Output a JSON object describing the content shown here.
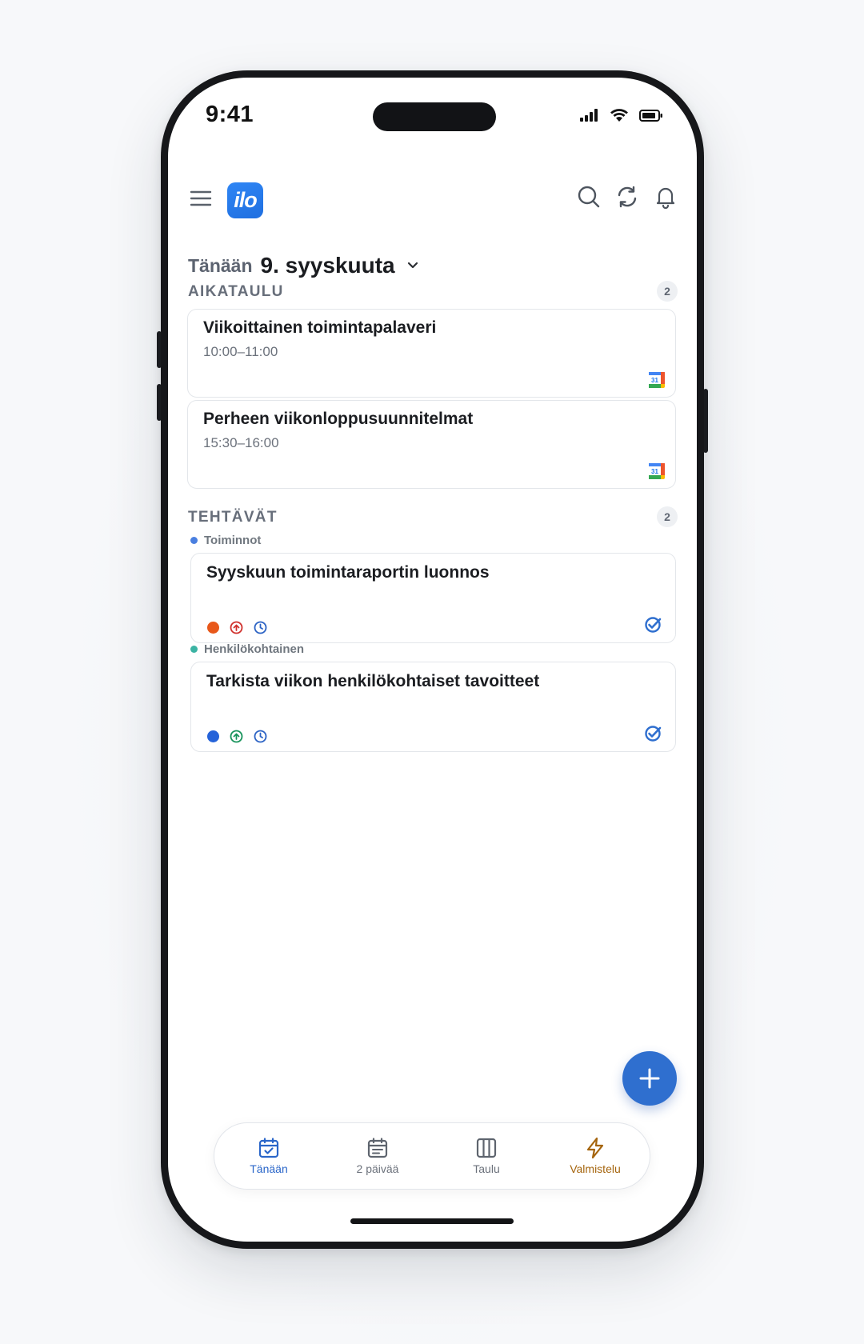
{
  "status": {
    "time": "9:41"
  },
  "header": {
    "logo_text": "ilo"
  },
  "date": {
    "today_label": "Tänään",
    "date_label": "9. syyskuuta"
  },
  "schedule": {
    "title": "AIKATAULU",
    "count": "2",
    "events": [
      {
        "title": "Viikoittainen toimintapalaveri",
        "time": "10:00–11:00"
      },
      {
        "title": "Perheen viikonloppusuunnitelmat",
        "time": "15:30–16:00"
      }
    ]
  },
  "tasks": {
    "title": "TEHTÄVÄT",
    "count": "2",
    "groups": [
      {
        "label": "Toiminnot",
        "color": "#4a7fe0",
        "task": {
          "title": "Syyskuun toimintaraportin luonnos",
          "status_color": "#e8581a",
          "priority_color": "#d0312d"
        }
      },
      {
        "label": "Henkilökohtainen",
        "color": "#3bb3a3",
        "task": {
          "title": "Tarkista viikon henkilökohtaiset tavoitteet",
          "status_color": "#2563d9",
          "priority_color": "#17935b"
        }
      }
    ]
  },
  "tabbar": {
    "tabs": [
      {
        "label": "Tänään",
        "icon": "calendar-check-icon"
      },
      {
        "label": "2 päivää",
        "icon": "calendar-list-icon"
      },
      {
        "label": "Taulu",
        "icon": "board-columns-icon"
      },
      {
        "label": "Valmistelu",
        "icon": "lightning-icon"
      }
    ]
  },
  "colors": {
    "accent": "#2f6fcf",
    "prep": "#a5650e"
  }
}
